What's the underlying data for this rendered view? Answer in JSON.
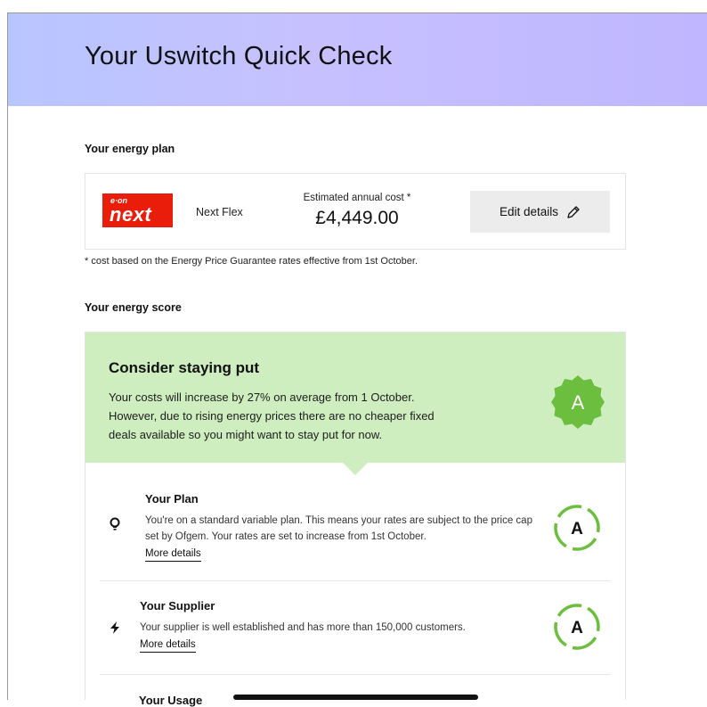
{
  "header": {
    "title": "Your Uswitch Quick Check"
  },
  "plan": {
    "section_label": "Your energy plan",
    "logo": {
      "eon": "e·on",
      "next": "next"
    },
    "plan_name": "Next Flex",
    "cost_label": "Estimated annual cost *",
    "cost_value": "£4,449.00",
    "edit_label": "Edit details",
    "edit_icon": "pencil-icon",
    "footnote": "* cost based on the Energy Price Guarantee rates effective from 1st October."
  },
  "score": {
    "section_label": "Your energy score",
    "title": "Consider staying put",
    "text": "Your costs will increase by 27% on average from 1 October. However, due to rising energy prices there are no cheaper fixed deals available so you might want to stay put for now.",
    "grade": "A",
    "rows": [
      {
        "title": "Your Plan",
        "icon": "lightbulb-icon",
        "text": "You're on a standard variable plan. This means your rates are subject to the price cap set by Ofgem. Your rates are set to increase from 1st October.",
        "link": "More details",
        "grade": "A"
      },
      {
        "title": "Your Supplier",
        "icon": "lightning-icon",
        "text": "Your supplier is well established and has more than 150,000 customers.",
        "link": "More details",
        "grade": "A"
      },
      {
        "title": "Your Usage"
      }
    ]
  },
  "colors": {
    "header_start": "#b8c6ff",
    "header_end": "#bfb6ff",
    "brand_red": "#ea1c0a",
    "score_bg": "#cfeec0",
    "badge_green": "#6cbf3e"
  }
}
